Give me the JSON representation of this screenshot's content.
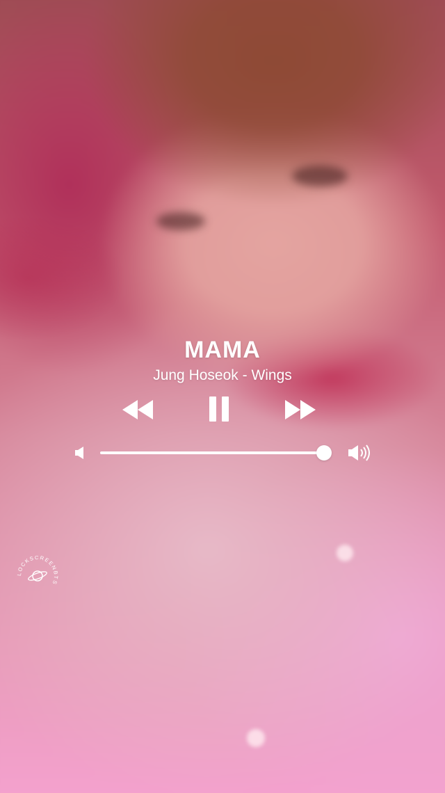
{
  "track": {
    "title": "MAMA",
    "artist_album": "Jung Hoseok - Wings"
  },
  "controls": {
    "rewind_icon": "rewind-icon",
    "pause_icon": "pause-icon",
    "forward_icon": "fast-forward-icon"
  },
  "volume": {
    "low_icon": "volume-low-icon",
    "high_icon": "volume-high-icon",
    "level": 0.97
  },
  "watermark": {
    "text": "LOCKSCREENBTS",
    "icon": "planet-icon"
  },
  "colors": {
    "foreground": "#ffffff"
  }
}
